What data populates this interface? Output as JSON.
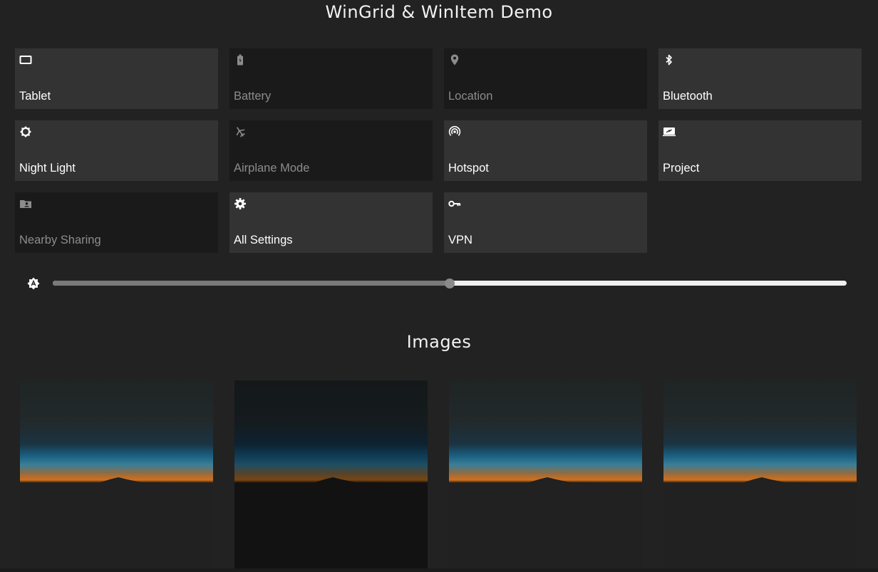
{
  "header": {
    "title": "WinGrid & WinItem Demo"
  },
  "tiles": [
    {
      "label": "Tablet",
      "icon": "tablet-icon",
      "state": "on"
    },
    {
      "label": "Battery",
      "icon": "battery-icon",
      "state": "off"
    },
    {
      "label": "Location",
      "icon": "location-icon",
      "state": "off"
    },
    {
      "label": "Bluetooth",
      "icon": "bluetooth-icon",
      "state": "on"
    },
    {
      "label": "Night Light",
      "icon": "brightness-icon",
      "state": "on"
    },
    {
      "label": "Airplane Mode",
      "icon": "airplane-icon",
      "state": "off"
    },
    {
      "label": "Hotspot",
      "icon": "hotspot-icon",
      "state": "on"
    },
    {
      "label": "Project",
      "icon": "project-icon",
      "state": "on"
    },
    {
      "label": "Nearby Sharing",
      "icon": "nearby-sharing-icon",
      "state": "off"
    },
    {
      "label": "All Settings",
      "icon": "gear-icon",
      "state": "on"
    },
    {
      "label": "VPN",
      "icon": "key-icon",
      "state": "on"
    }
  ],
  "brightness": {
    "icon": "auto-brightness-icon",
    "value": 0.5
  },
  "images_section": {
    "title": "Images",
    "items": [
      {
        "name": "sunset-horizon-image",
        "dimmed": false
      },
      {
        "name": "sunset-horizon-image",
        "dimmed": true
      },
      {
        "name": "sunset-horizon-image",
        "dimmed": false
      },
      {
        "name": "sunset-horizon-image",
        "dimmed": false
      }
    ]
  },
  "colors": {
    "background": "#222222",
    "tile_on": "#333333",
    "tile_off": "#1a1a1a",
    "label_off": "#8c8c8c",
    "slider_fill": "#7a7a7a",
    "slider_track": "#efefef"
  }
}
